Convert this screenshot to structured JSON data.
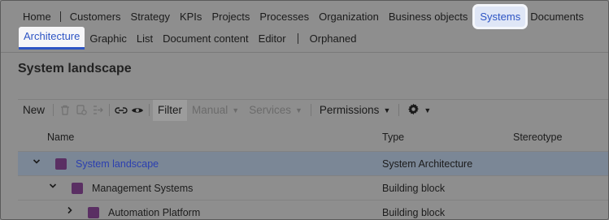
{
  "nav_primary": {
    "items": [
      "Home",
      "Customers",
      "Strategy",
      "KPIs",
      "Projects",
      "Processes",
      "Organization",
      "Business objects",
      "Systems",
      "Documents"
    ],
    "active": "Systems"
  },
  "nav_secondary": {
    "items": [
      "Architecture",
      "Graphic",
      "List",
      "Document content",
      "Editor",
      "Orphaned"
    ],
    "active": "Architecture"
  },
  "page": {
    "title": "System landscape"
  },
  "toolbar": {
    "new_label": "New",
    "filter_label": "Filter",
    "manual_label": "Manual",
    "services_label": "Services",
    "permissions_label": "Permissions",
    "icons": [
      "trash-icon",
      "copy-icon",
      "move-icon",
      "link-icon",
      "eye-icon",
      "gear-icon"
    ]
  },
  "table": {
    "columns": {
      "name": "Name",
      "type": "Type",
      "stereotype": "Stereotype"
    },
    "rows": [
      {
        "name": "System landscape",
        "type": "System Architecture",
        "stereotype": "",
        "expanded": true,
        "selected": true
      },
      {
        "name": "Management Systems",
        "type": "Building block",
        "stereotype": "",
        "expanded": true,
        "selected": false
      },
      {
        "name": "Automation Platform",
        "type": "Building block",
        "stereotype": "",
        "expanded": false,
        "selected": false
      }
    ]
  },
  "colors": {
    "accent": "#2d54c4",
    "item_square": "#5a2f63",
    "overlay_background": "#8e8e8e"
  }
}
